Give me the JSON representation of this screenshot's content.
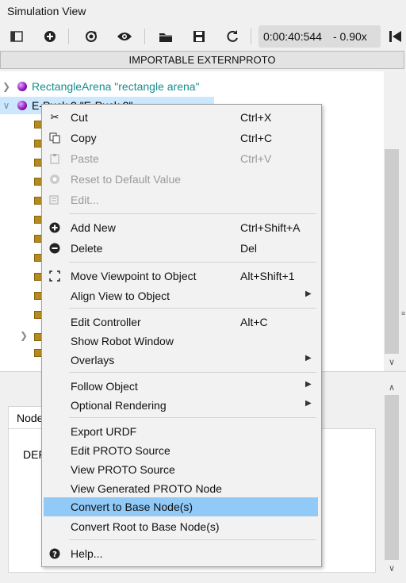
{
  "window": {
    "title": "Simulation View"
  },
  "toolbar": {
    "time": "0:00:40:544",
    "speed": "- 0.90x",
    "buttons": [
      "sidebar-toggle-icon",
      "add-node-icon",
      "reset-view-icon",
      "visibility-icon",
      "open-folder-icon",
      "save-icon",
      "reload-icon",
      "step-back-icon"
    ]
  },
  "import_bar": {
    "label": "IMPORTABLE EXTERNPROTO"
  },
  "tree": {
    "arena_label": "RectangleArena \"rectangle arena\"",
    "robot_label": "E-Puck 2 \"E-Puck 2\""
  },
  "bottom": {
    "tab_label": "Node",
    "def_label": "DEF"
  },
  "menu": {
    "cut": {
      "label": "Cut",
      "shortcut": "Ctrl+X"
    },
    "copy": {
      "label": "Copy",
      "shortcut": "Ctrl+C"
    },
    "paste": {
      "label": "Paste",
      "shortcut": "Ctrl+V"
    },
    "reset": {
      "label": "Reset to Default Value"
    },
    "edit": {
      "label": "Edit..."
    },
    "add_new": {
      "label": "Add New",
      "shortcut": "Ctrl+Shift+A"
    },
    "delete": {
      "label": "Delete",
      "shortcut": "Del"
    },
    "move_viewpoint": {
      "label": "Move Viewpoint to Object",
      "shortcut": "Alt+Shift+1"
    },
    "align_view": {
      "label": "Align View to Object"
    },
    "edit_controller": {
      "label": "Edit Controller",
      "shortcut": "Alt+C"
    },
    "show_robot_window": {
      "label": "Show Robot Window"
    },
    "overlays": {
      "label": "Overlays"
    },
    "follow_object": {
      "label": "Follow Object"
    },
    "optional_rendering": {
      "label": "Optional Rendering"
    },
    "export_urdf": {
      "label": "Export URDF"
    },
    "edit_proto": {
      "label": "Edit PROTO Source"
    },
    "view_proto": {
      "label": "View PROTO Source"
    },
    "view_generated": {
      "label": "View Generated PROTO Node"
    },
    "convert_base": {
      "label": "Convert to Base Node(s)"
    },
    "convert_root": {
      "label": "Convert Root to Base Node(s)"
    },
    "help": {
      "label": "Help..."
    }
  }
}
